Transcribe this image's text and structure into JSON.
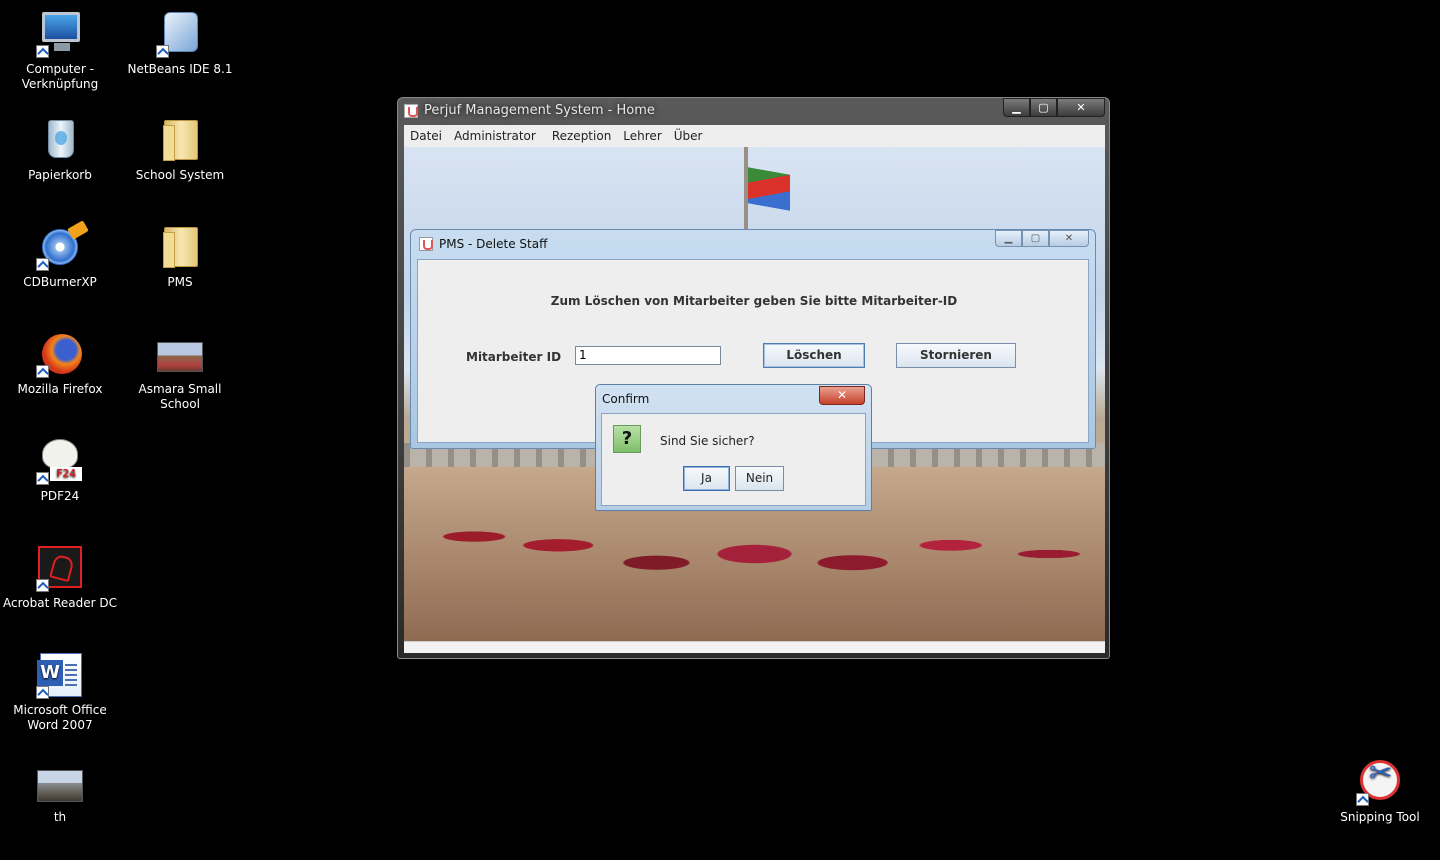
{
  "desktop": {
    "icons": [
      {
        "label": "Computer -\nVerknüpfung",
        "icon": "computer-icon"
      },
      {
        "label": "NetBeans IDE 8.1",
        "icon": "netbeans-icon"
      },
      {
        "label": "Papierkorb",
        "icon": "recycle-bin-icon"
      },
      {
        "label": "School System",
        "icon": "folder-icon"
      },
      {
        "label": "CDBurnerXP",
        "icon": "cdburner-icon"
      },
      {
        "label": "PMS",
        "icon": "folder-icon"
      },
      {
        "label": "Mozilla Firefox",
        "icon": "firefox-icon"
      },
      {
        "label": "Asmara Small School",
        "icon": "image-thumbnail-icon"
      },
      {
        "label": "PDF24",
        "icon": "pdf24-icon"
      },
      {
        "label": "Acrobat Reader DC",
        "icon": "acrobat-icon"
      },
      {
        "label": "Microsoft Office\nWord 2007",
        "icon": "word-icon"
      },
      {
        "label": "th",
        "icon": "image-thumbnail-icon"
      },
      {
        "label": "Snipping Tool",
        "icon": "snipping-tool-icon"
      }
    ]
  },
  "main_window": {
    "title": "Perjuf Management System - Home",
    "caption": {
      "minimize": "▁",
      "maximize": "▢",
      "close": "✕"
    },
    "menu": [
      "Datei",
      "Administrator",
      "Rezeption",
      "Lehrer",
      "Über"
    ]
  },
  "delete_window": {
    "title": "PMS - Delete Staff",
    "caption": {
      "minimize": "▁",
      "maximize": "▢",
      "close": "✕"
    },
    "prompt": "Zum Löschen von Mitarbeiter geben Sie bitte Mitarbeiter-ID",
    "id_label": "Mitarbeiter ID",
    "id_value": "1",
    "delete_button": "Löschen",
    "cancel_button": "Stornieren"
  },
  "confirm_dialog": {
    "title": "Confirm",
    "close": "✕",
    "icon_glyph": "?",
    "message": "Sind Sie sicher?",
    "yes_button": "Ja",
    "no_button": "Nein"
  },
  "colors": {
    "desktop_background": "#000000",
    "window_client": "#eeeeee",
    "dialog_frame": "#b5cde6"
  }
}
